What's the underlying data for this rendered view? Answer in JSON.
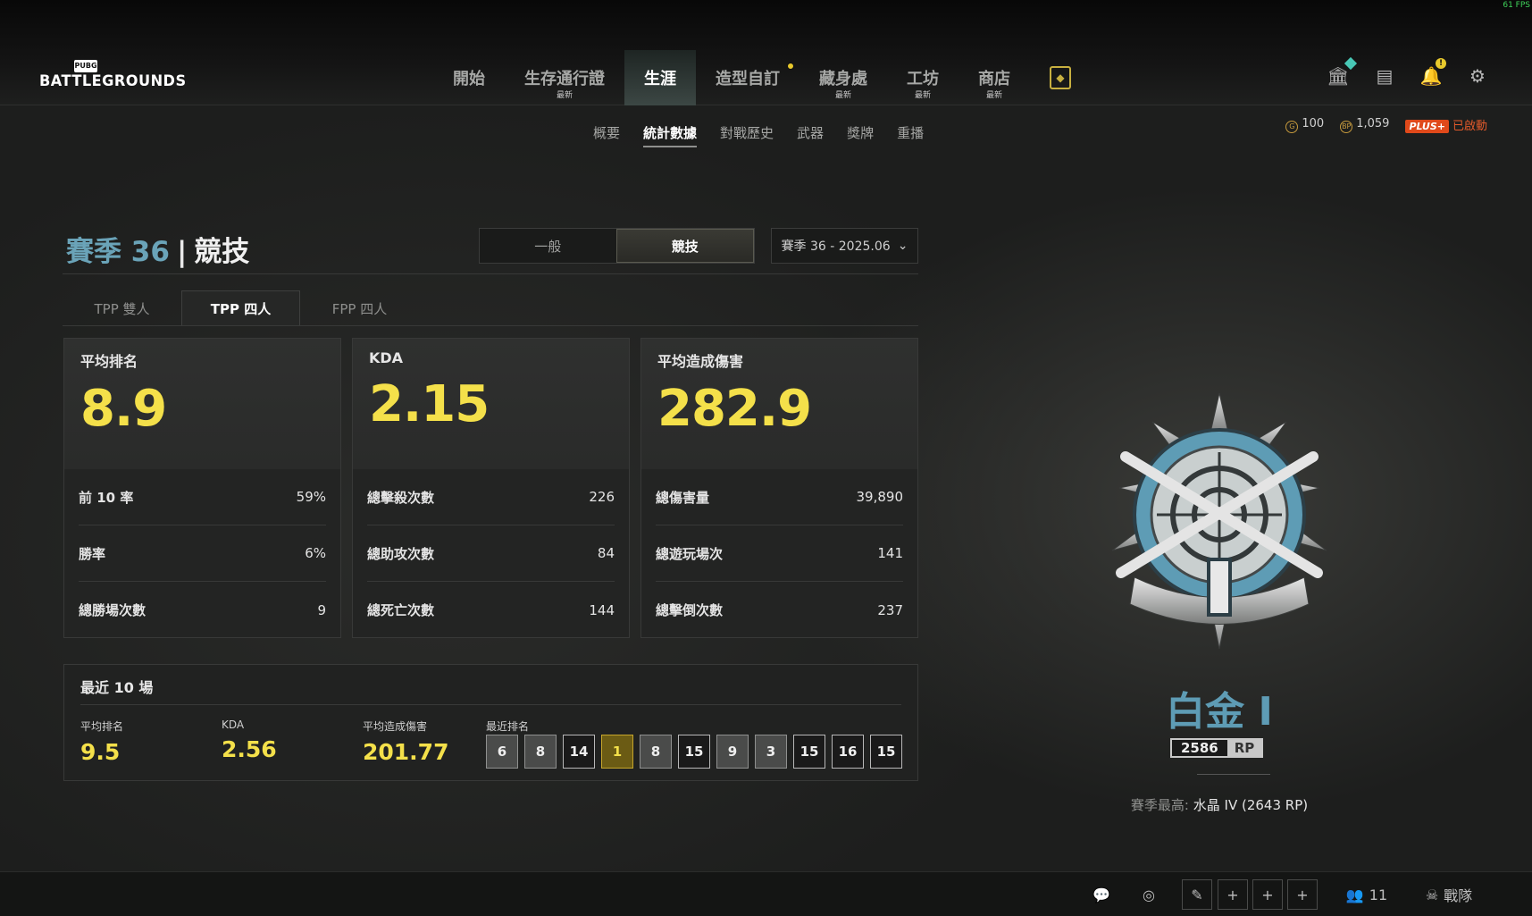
{
  "fps": "61 FPS",
  "logo": {
    "top": "PUBG",
    "main": "BATTLEGROUNDS"
  },
  "nav": [
    {
      "label": "開始",
      "new": ""
    },
    {
      "label": "生存通行證",
      "new": "最新"
    },
    {
      "label": "生涯",
      "new": "",
      "active": true
    },
    {
      "label": "造型自訂",
      "new": ""
    },
    {
      "label": "藏身處",
      "new": "最新"
    },
    {
      "label": "工坊",
      "new": "最新"
    },
    {
      "label": "商店",
      "new": "最新"
    }
  ],
  "subnav": [
    "概要",
    "統計數據",
    "對戰歷史",
    "武器",
    "獎牌",
    "重播"
  ],
  "currency": {
    "g_coin": "100",
    "bp": "1,059",
    "plus_label": "PLUS+",
    "plus_status": "已啟動"
  },
  "season": {
    "title_a": "賽季 36",
    "title_b": "競技",
    "mode_normal": "一般",
    "mode_ranked": "競技",
    "select": "賽季 36 - 2025.06"
  },
  "tabs": [
    "TPP 雙人",
    "TPP 四人",
    "FPP 四人"
  ],
  "cards": [
    {
      "label": "平均排名",
      "big": "8.9",
      "rows": [
        {
          "k": "前 10 率",
          "v": "59%"
        },
        {
          "k": "勝率",
          "v": "6%"
        },
        {
          "k": "總勝場次數",
          "v": "9"
        }
      ]
    },
    {
      "label": "KDA",
      "big": "2.15",
      "rows": [
        {
          "k": "總擊殺次數",
          "v": "226"
        },
        {
          "k": "總助攻次數",
          "v": "84"
        },
        {
          "k": "總死亡次數",
          "v": "144"
        }
      ]
    },
    {
      "label": "平均造成傷害",
      "big": "282.9",
      "rows": [
        {
          "k": "總傷害量",
          "v": "39,890"
        },
        {
          "k": "總遊玩場次",
          "v": "141"
        },
        {
          "k": "總擊倒次數",
          "v": "237"
        }
      ]
    }
  ],
  "recent": {
    "title": "最近 10 場",
    "avg_rank_label": "平均排名",
    "avg_rank": "9.5",
    "kda_label": "KDA",
    "kda": "2.56",
    "dmg_label": "平均造成傷害",
    "dmg": "201.77",
    "ranks_label": "最近排名",
    "ranks": [
      "6",
      "8",
      "14",
      "1",
      "8",
      "15",
      "9",
      "3",
      "15",
      "16",
      "15"
    ]
  },
  "rank": {
    "name": "白金 I",
    "rp_value": "2586",
    "rp_unit": "RP",
    "best_label": "賽季最高:",
    "best_value": "水晶 IV (2643 RP)"
  },
  "bottom": {
    "friends": "11",
    "team": "戰隊"
  },
  "colors": {
    "accent_yellow": "#f4e04a",
    "rank_blue": "#5e9cb5",
    "plus_orange": "#e0491a"
  }
}
